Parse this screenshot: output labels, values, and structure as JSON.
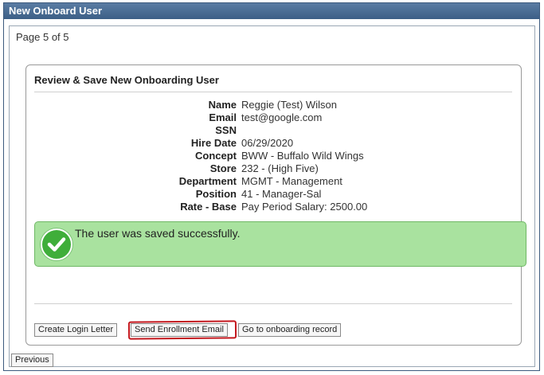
{
  "window": {
    "title": "New Onboard User"
  },
  "page": {
    "indicator": "Page 5 of 5"
  },
  "panel": {
    "title": "Review & Save New Onboarding User",
    "fields": [
      {
        "label": "Name",
        "value": "Reggie (Test) Wilson"
      },
      {
        "label": "Email",
        "value": "test@google.com"
      },
      {
        "label": "SSN",
        "value": ""
      },
      {
        "label": "Hire Date",
        "value": "06/29/2020"
      },
      {
        "label": "Concept",
        "value": "BWW - Buffalo Wild Wings"
      },
      {
        "label": "Store",
        "value": "232 - (High Five)"
      },
      {
        "label": "Department",
        "value": "MGMT - Management"
      },
      {
        "label": "Position",
        "value": "41 - Manager-Sal"
      },
      {
        "label": "Rate - Base",
        "value": "Pay Period Salary: 2500.00"
      }
    ],
    "success_message": "The user was saved successfully.",
    "buttons": {
      "create_login_letter": "Create Login Letter",
      "send_enrollment_email": "Send Enrollment Email",
      "go_to_record": "Go to onboarding record"
    }
  },
  "footer": {
    "previous": "Previous"
  },
  "colors": {
    "titlebar": "#3c5f86",
    "success_bg": "#a9e29f",
    "success_icon": "#3fae3a",
    "highlight": "#c3161c"
  },
  "icons": {
    "success": "checkmark-circle-icon"
  }
}
